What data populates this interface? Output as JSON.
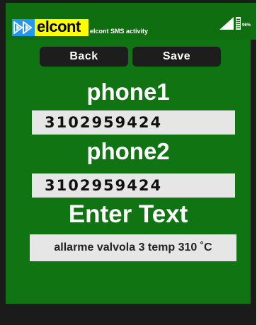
{
  "header": {
    "logo_text": "elcont",
    "app_title": "elcont SMS activity",
    "battery_text": "96%"
  },
  "toolbar": {
    "back_label": "Back",
    "save_label": "Save"
  },
  "form": {
    "phone1_label": "phone1",
    "phone1_value": "3102959424",
    "phone2_label": "phone2",
    "phone2_value": "3102959424",
    "text_label": "Enter Text",
    "text_value": "allarme valvola 3 temp 310 ˚C"
  },
  "colors": {
    "background": "#0f7411",
    "frame": "#1b1b1b",
    "logo_yellow": "#ffff00",
    "logo_blue": "#2196f3",
    "field": "#e6e6e6"
  },
  "icons": [
    "logo-arrows-icon",
    "signal-icon",
    "battery-icon"
  ]
}
